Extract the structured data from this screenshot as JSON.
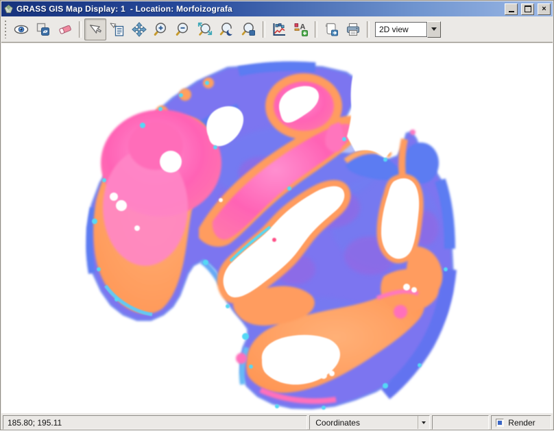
{
  "window": {
    "title": "GRASS GIS Map Display: 1  - Location: Morfoizografa",
    "app_icon": "grass-gis-gem-icon",
    "controls": [
      {
        "name": "minimize",
        "icon": "minimize-icon"
      },
      {
        "name": "maximize",
        "icon": "maximize-icon"
      },
      {
        "name": "close",
        "icon": "close-icon"
      }
    ]
  },
  "toolbar": {
    "tools": [
      {
        "name": "display-map",
        "icon": "eye-icon"
      },
      {
        "name": "render-map",
        "icon": "refresh-squares-icon"
      },
      {
        "name": "erase-display",
        "icon": "eraser-icon"
      },
      {
        "name": "pointer",
        "icon": "cursor-arrow-icon",
        "active": true
      },
      {
        "name": "query",
        "icon": "cursor-list-icon"
      },
      {
        "name": "pan",
        "icon": "pan-arrows-icon"
      },
      {
        "name": "zoom-in",
        "icon": "magnifier-plus-icon"
      },
      {
        "name": "zoom-out",
        "icon": "magnifier-minus-icon"
      },
      {
        "name": "zoom-rectangle",
        "icon": "magnifier-arrows-icon"
      },
      {
        "name": "zoom-back",
        "icon": "magnifier-moon-icon"
      },
      {
        "name": "zoom-region",
        "icon": "magnifier-square-icon"
      },
      {
        "name": "analyze",
        "icon": "chart-profile-icon"
      },
      {
        "name": "add-overlay",
        "icon": "legend-a-plus-icon"
      },
      {
        "name": "save-display",
        "icon": "page-export-icon"
      },
      {
        "name": "print-display",
        "icon": "printer-icon"
      }
    ],
    "view_mode": "2D view"
  },
  "statusbar": {
    "coordinates": "185.80; 195.11",
    "mode": "Coordinates",
    "render_label": "Render",
    "render_checked": true
  },
  "map": {
    "type": "raster-display",
    "palette": {
      "background": "#ffffff",
      "base_purple": "#7b74f0",
      "blue": "#5b7bf2",
      "cyan": "#55d8f5",
      "orange": "#ff9c5e",
      "pink": "#ff63b5",
      "magenta_purple": "#9a64e0"
    }
  }
}
